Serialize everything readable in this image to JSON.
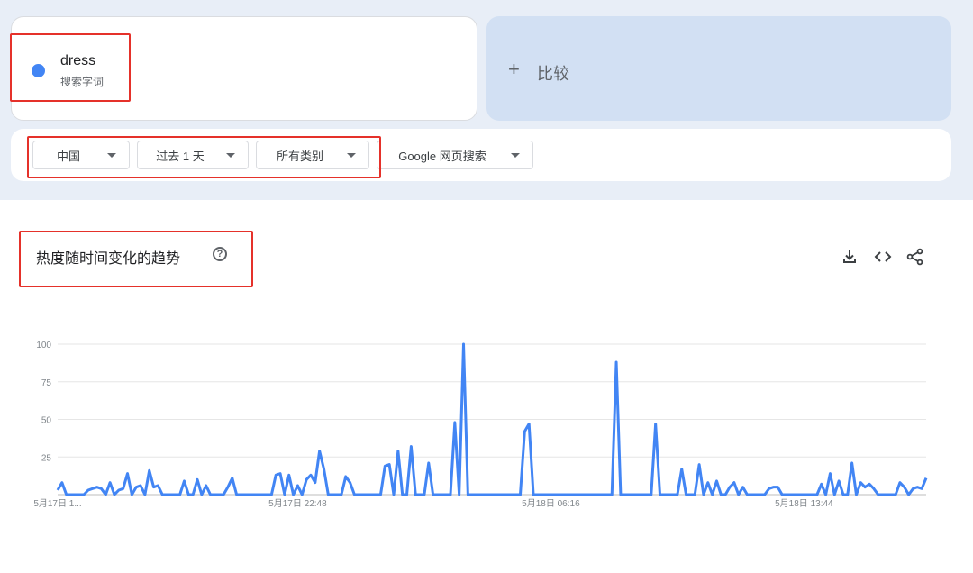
{
  "term_card": {
    "term": "dress",
    "term_type": "搜索字词",
    "dot_color": "#4285f4"
  },
  "compare": {
    "plus_icon": "+",
    "label": "比较"
  },
  "filters": {
    "region": "中国",
    "time_range": "过去 1 天",
    "category": "所有类别",
    "search_type": "Google 网页搜索"
  },
  "chart_card": {
    "title": "热度随时间变化的趋势",
    "help_icon": "?",
    "tools": [
      "download-icon",
      "embed-code-icon",
      "share-icon"
    ]
  },
  "chart_data": {
    "type": "line",
    "ylim": [
      0,
      100
    ],
    "y_ticks": [
      "100",
      "75",
      "50",
      "25"
    ],
    "x_tick_labels": [
      "5月17日 1...",
      "5月17日 22:48",
      "5月18日 06:16",
      "5月18日 13:44"
    ],
    "x_tick_index": [
      0,
      55,
      113,
      171
    ],
    "line_color": "#4285f4",
    "grid": true,
    "series": [
      {
        "values": [
          3,
          8,
          0,
          0,
          0,
          0,
          0,
          3,
          4,
          5,
          4,
          0,
          8,
          0,
          3,
          4,
          14,
          0,
          5,
          6,
          0,
          16,
          5,
          6,
          0,
          0,
          0,
          0,
          0,
          9,
          0,
          0,
          10,
          0,
          6,
          0,
          0,
          0,
          0,
          5,
          11,
          0,
          0,
          0,
          0,
          0,
          0,
          0,
          0,
          0,
          13,
          14,
          0,
          13,
          0,
          6,
          0,
          10,
          13,
          8,
          29,
          17,
          0,
          0,
          0,
          0,
          12,
          8,
          0,
          0,
          0,
          0,
          0,
          0,
          0,
          19,
          20,
          0,
          29,
          0,
          0,
          32,
          0,
          0,
          0,
          21,
          0,
          0,
          0,
          0,
          0,
          48,
          0,
          100,
          0,
          0,
          0,
          0,
          0,
          0,
          0,
          0,
          0,
          0,
          0,
          0,
          0,
          42,
          47,
          0,
          0,
          0,
          0,
          0,
          0,
          0,
          0,
          0,
          0,
          0,
          0,
          0,
          0,
          0,
          0,
          0,
          0,
          0,
          88,
          0,
          0,
          0,
          0,
          0,
          0,
          0,
          0,
          47,
          0,
          0,
          0,
          0,
          0,
          17,
          0,
          0,
          0,
          20,
          0,
          8,
          0,
          9,
          0,
          0,
          5,
          8,
          0,
          5,
          0,
          0,
          0,
          0,
          0,
          4,
          5,
          5,
          0,
          0,
          0,
          0,
          0,
          0,
          0,
          0,
          0,
          7,
          0,
          14,
          0,
          9,
          0,
          0,
          21,
          0,
          8,
          5,
          7,
          4,
          0,
          0,
          0,
          0,
          0,
          8,
          5,
          0,
          4,
          5,
          4,
          11
        ]
      }
    ]
  }
}
